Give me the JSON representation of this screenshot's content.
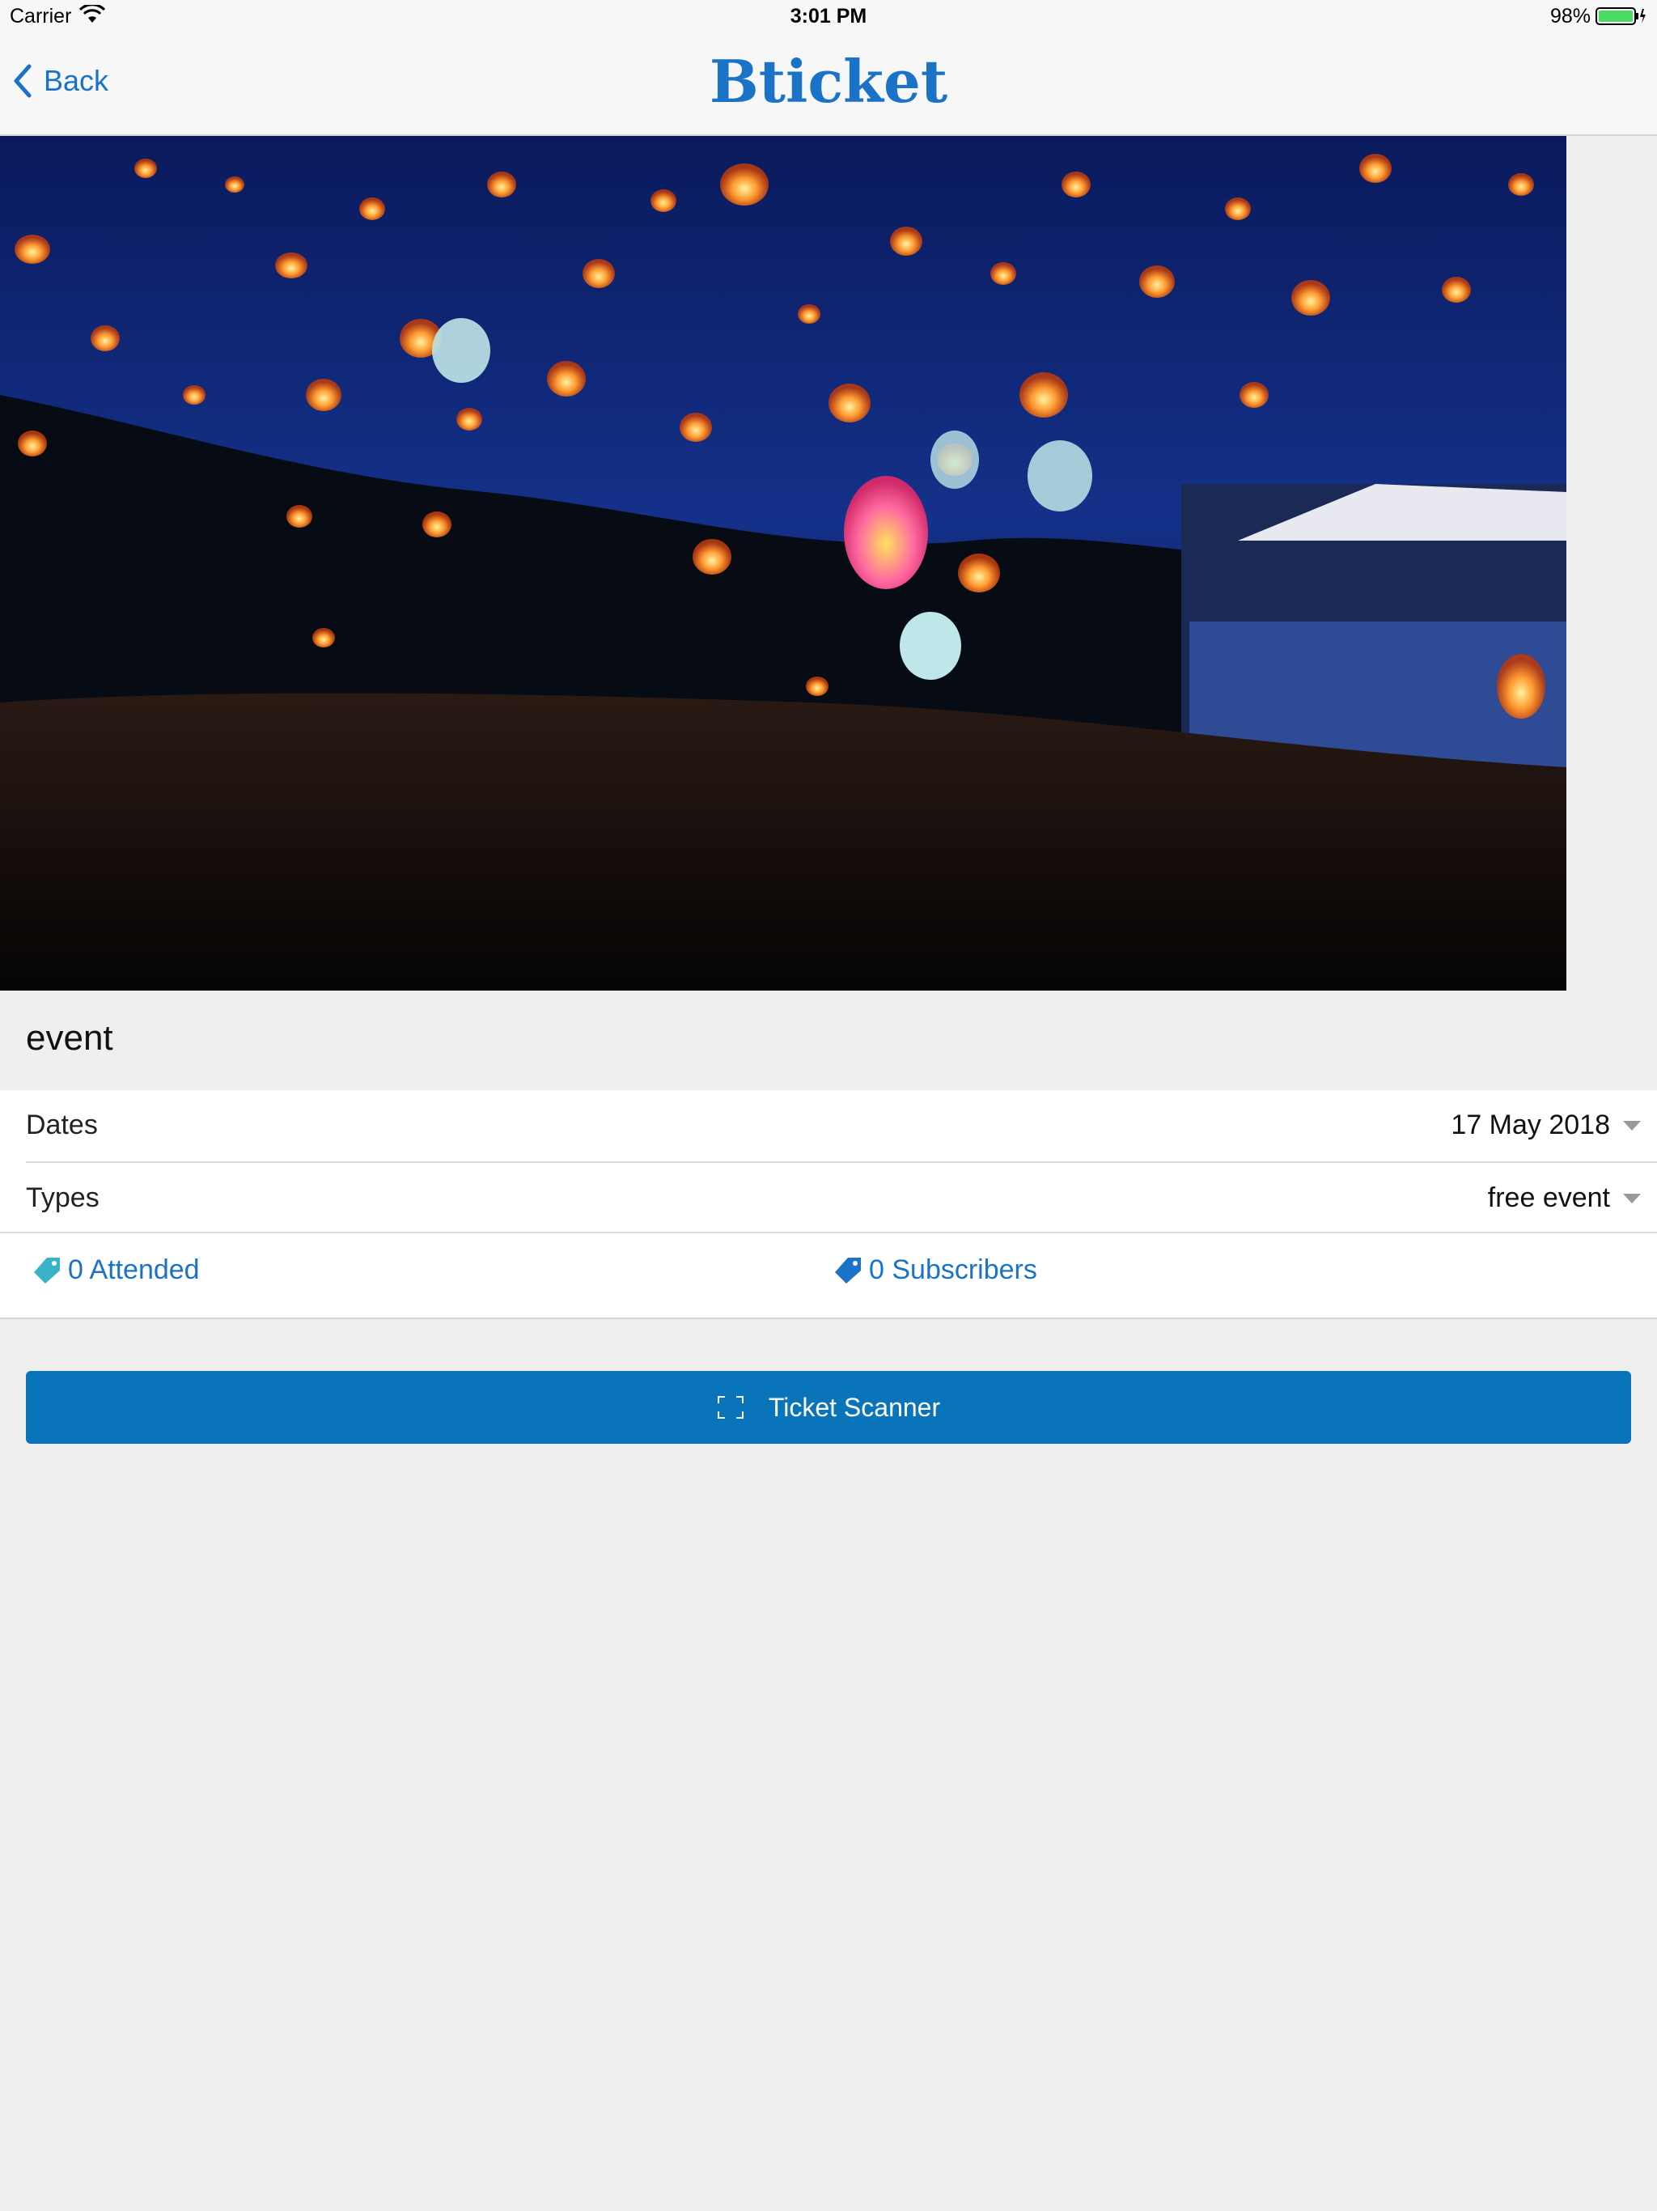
{
  "status_bar": {
    "carrier": "Carrier",
    "time": "3:01 PM",
    "battery": "98%"
  },
  "nav": {
    "back_label": "Back",
    "logo": "Bticket"
  },
  "event": {
    "title": "event",
    "dates_label": "Dates",
    "dates_value": "17 May 2018",
    "types_label": "Types",
    "types_value": "free event",
    "attended": "0 Attended",
    "subscribers": "0 Subscribers"
  },
  "actions": {
    "scanner_label": "Ticket Scanner"
  },
  "colors": {
    "accent": "#1a73c6",
    "button": "#0a74bb",
    "background": "#efefef"
  },
  "icons": {
    "back": "chevron-left-icon",
    "tag": "tag-icon",
    "scanner": "scan-frame-icon",
    "wifi": "wifi-icon",
    "battery": "battery-icon"
  }
}
